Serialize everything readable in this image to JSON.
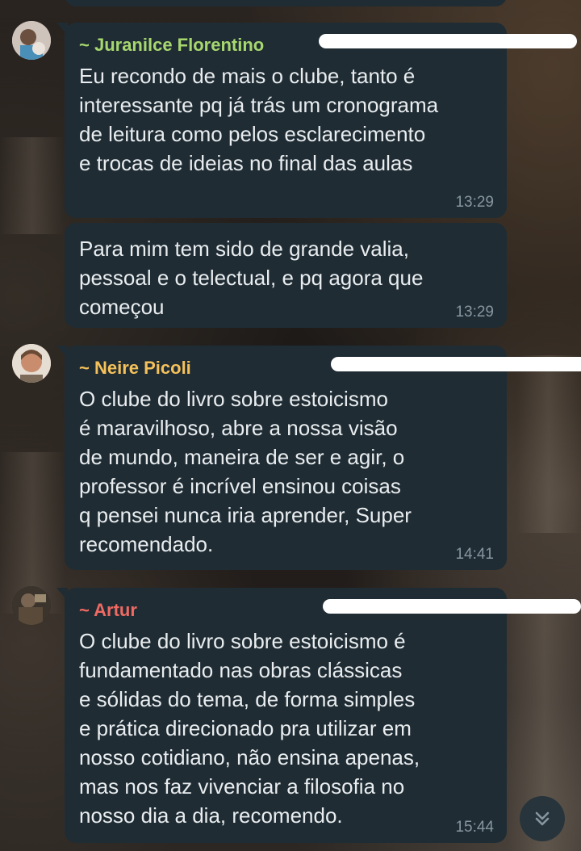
{
  "messages": [
    {
      "sender": "~ Juranilce Florentino",
      "sender_color": "#a7d86f",
      "text": "Eu recondo de mais o clube, tanto é\ninteressante pq já trás um cronograma\nde leitura como pelos esclarecimento\ne trocas de ideias no final das aulas",
      "time": "13:29",
      "avatar": "user-avatar-icon"
    },
    {
      "text": "Para mim tem sido de grande valia,\npessoal e o telectual, e pq agora que\ncomeçou",
      "time": "13:29"
    },
    {
      "sender": "~ Neire Picoli",
      "sender_color": "#f5c15a",
      "text": "O clube do livro sobre estoicismo\né maravilhoso, abre a nossa visão\nde mundo, maneira de ser e agir, o\nprofessor é incrível ensinou coisas\nq pensei nunca iria aprender,  Super\nrecomendado.",
      "time": "14:41",
      "avatar": "user-avatar-icon"
    },
    {
      "sender": "~ Artur",
      "sender_color": "#ef6a63",
      "text": "O clube do livro sobre estoicismo é\nfundamentado nas obras clássicas\ne sólidas do tema, de forma simples\ne prática direcionado pra utilizar em\nnosso cotidiano, não ensina apenas,\nmas nos faz vivenciar a filosofia no\nnosso dia a dia, recomendo.",
      "time": "15:44",
      "avatar": "user-avatar-icon"
    }
  ],
  "scroll_button": {
    "icon": "double-chevron-down-icon"
  },
  "colors": {
    "bubble": "#1f2c34",
    "text": "#e9edef",
    "time": "#8696a0"
  }
}
